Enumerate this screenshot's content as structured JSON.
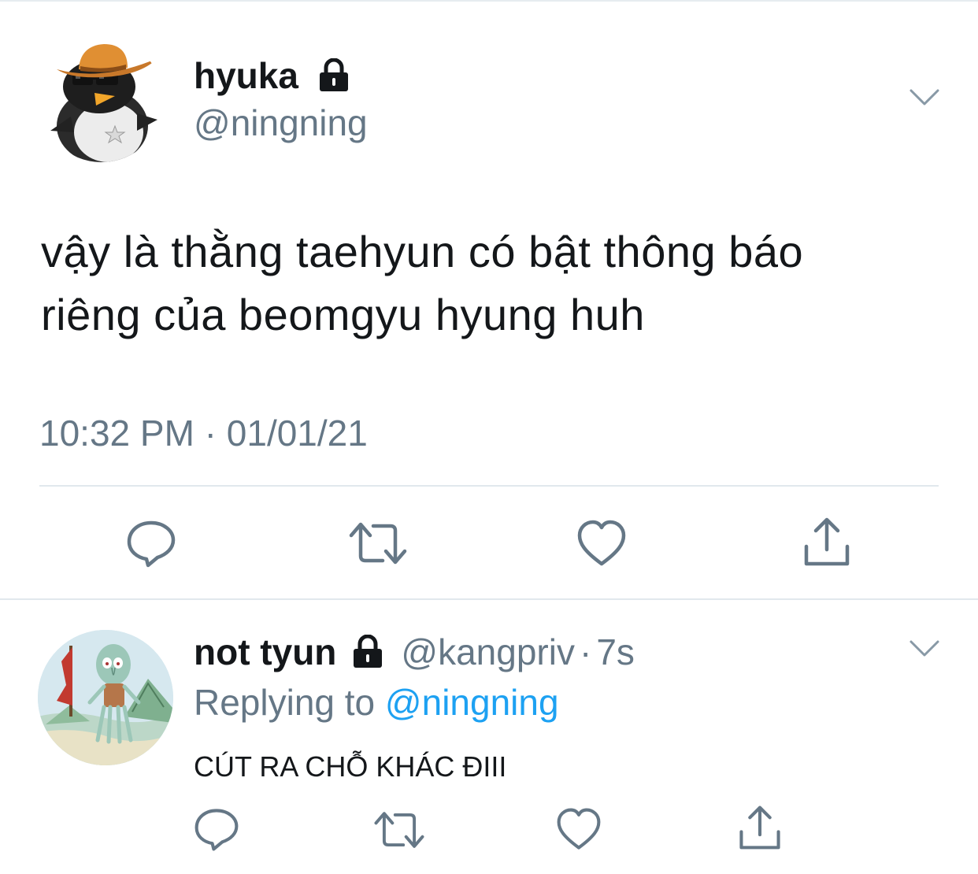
{
  "main_tweet": {
    "display_name": "hyuka",
    "handle": "@ningning",
    "text_line1": "vậy là thằng taehyun có bật thông báo",
    "text_line2": "riêng của beomgyu hyung huh",
    "timestamp": "10:32 PM · 01/01/21",
    "protected_icon": "lock-icon",
    "menu_icon": "chevron-down-icon",
    "actions": [
      "reply-icon",
      "retweet-icon",
      "like-icon",
      "share-icon"
    ]
  },
  "reply_tweet": {
    "display_name": "not tyun",
    "handle": "@kangpriv",
    "separator": "·",
    "time": "7s",
    "replying_prefix": "Replying to",
    "replying_to": "@ningning",
    "text": "CÚT RA CHỖ KHÁC ĐIII",
    "protected_icon": "lock-icon",
    "menu_icon": "chevron-down-icon",
    "actions": [
      "reply-icon",
      "retweet-icon",
      "like-icon",
      "share-icon"
    ]
  },
  "colors": {
    "text_primary": "#14171a",
    "text_secondary": "#657786",
    "link": "#1da1f2",
    "divider": "#e1e8ed",
    "icon": "#657786"
  }
}
